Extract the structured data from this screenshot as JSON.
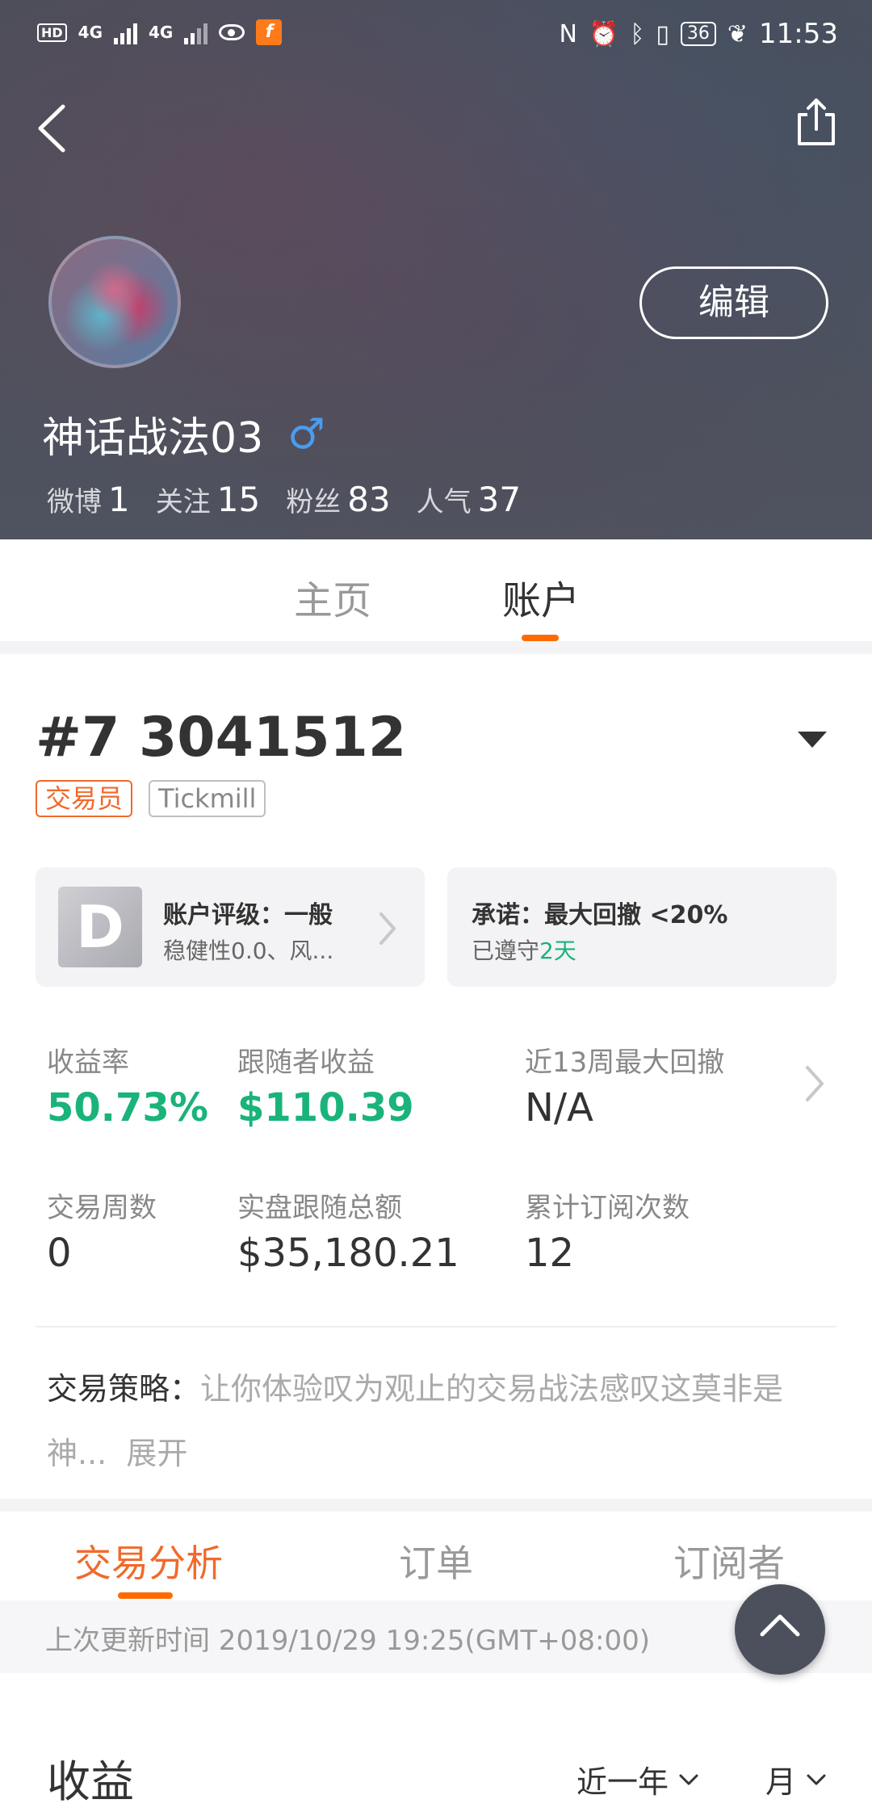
{
  "status_bar": {
    "left_labels": [
      "HD",
      "4G",
      "4G"
    ],
    "battery": "36",
    "time": "11:53"
  },
  "profile": {
    "username": "神话战法03",
    "gender_symbol": "♂",
    "edit_label": "编辑",
    "stats": [
      {
        "label": "微博",
        "value": "1"
      },
      {
        "label": "关注",
        "value": "15"
      },
      {
        "label": "粉丝",
        "value": "83"
      },
      {
        "label": "人气",
        "value": "37"
      }
    ]
  },
  "main_tabs": [
    {
      "label": "主页",
      "active": false
    },
    {
      "label": "账户",
      "active": true
    }
  ],
  "account": {
    "number": "#7 3041512",
    "tags": [
      "交易员",
      "Tickmill"
    ],
    "rating_card": {
      "grade": "D",
      "title": "账户评级：一般",
      "subtitle": "稳健性0.0、风..."
    },
    "promise_card": {
      "title": "承诺：最大回撤 <20%",
      "sub_prefix": "已遵守",
      "sub_value": "2天"
    }
  },
  "metrics": [
    {
      "label": "收益率",
      "value": "50.73%",
      "highlight": true
    },
    {
      "label": "跟随者收益",
      "value": "$110.39",
      "highlight": true
    },
    {
      "label": "近13周最大回撤",
      "value": "N/A",
      "highlight": false
    },
    {
      "label": "交易周数",
      "value": "0",
      "highlight": false
    },
    {
      "label": "实盘跟随总额",
      "value": "$35,180.21",
      "highlight": false
    },
    {
      "label": "累计订阅次数",
      "value": "12",
      "highlight": false
    }
  ],
  "strategy": {
    "label": "交易策略：",
    "text": "让你体验叹为观止的交易战法感叹这莫非是神...",
    "expand": "展开"
  },
  "sub_tabs": [
    {
      "label": "交易分析",
      "active": true
    },
    {
      "label": "订单",
      "active": false
    },
    {
      "label": "订阅者",
      "active": false
    }
  ],
  "update_text": "上次更新时间 2019/10/29 19:25(GMT+08:00)",
  "earnings": {
    "title": "收益",
    "range_select": "近一年",
    "period_select": "月"
  },
  "colors": {
    "accent_orange": "#ff6a00",
    "positive_green": "#1ab37a",
    "gender_blue": "#4a9cf0"
  }
}
